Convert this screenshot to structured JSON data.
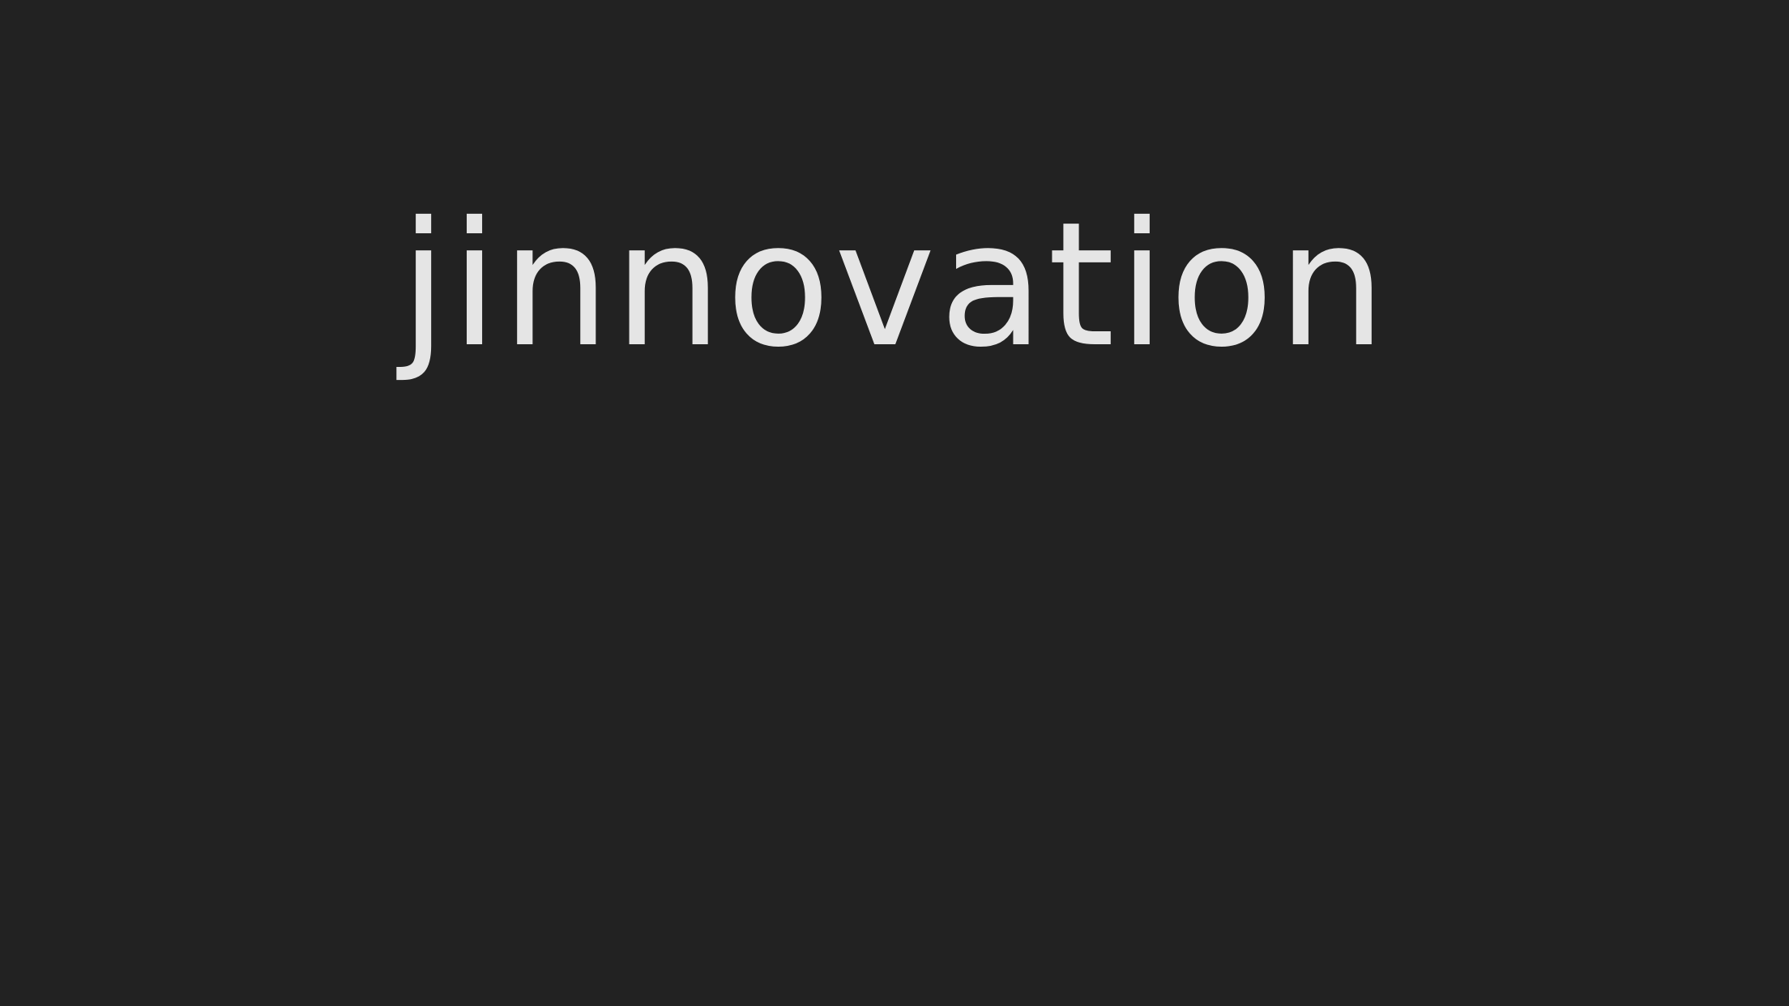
{
  "splash": {
    "wordmark": "jinnovation"
  },
  "colors": {
    "background": "#222222",
    "wordmark": "#e5e5e5"
  }
}
